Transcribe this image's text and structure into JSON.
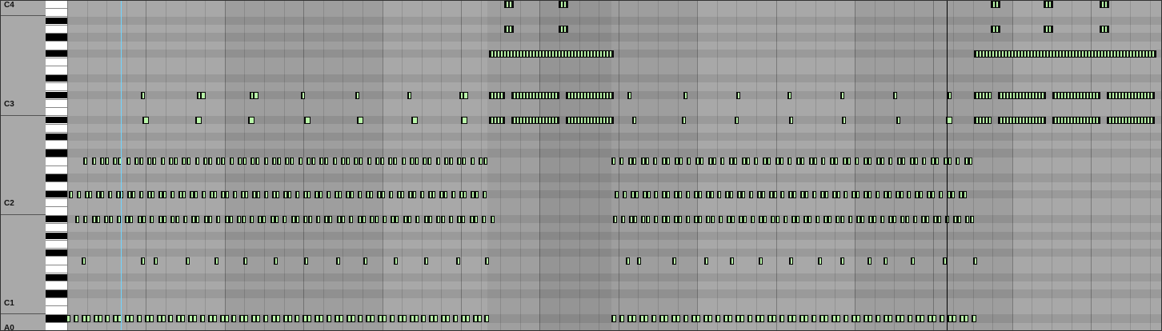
{
  "octave_labels": [
    {
      "id": "c4",
      "text": "C4"
    },
    {
      "id": "c3",
      "text": "C3"
    },
    {
      "id": "c2",
      "text": "C2"
    },
    {
      "id": "c1",
      "text": "C1"
    },
    {
      "id": "a0",
      "text": "A0"
    }
  ],
  "colors": {
    "note_fill": "#b8f5a8",
    "note_border": "#0a0a0a",
    "grid_background": "#a8a8a8",
    "black_key_row": "#9a9a9a",
    "cursor": "#6fd6ff",
    "playhead": "#000000"
  },
  "range": {
    "lowest": "A0",
    "highest": "C4"
  }
}
